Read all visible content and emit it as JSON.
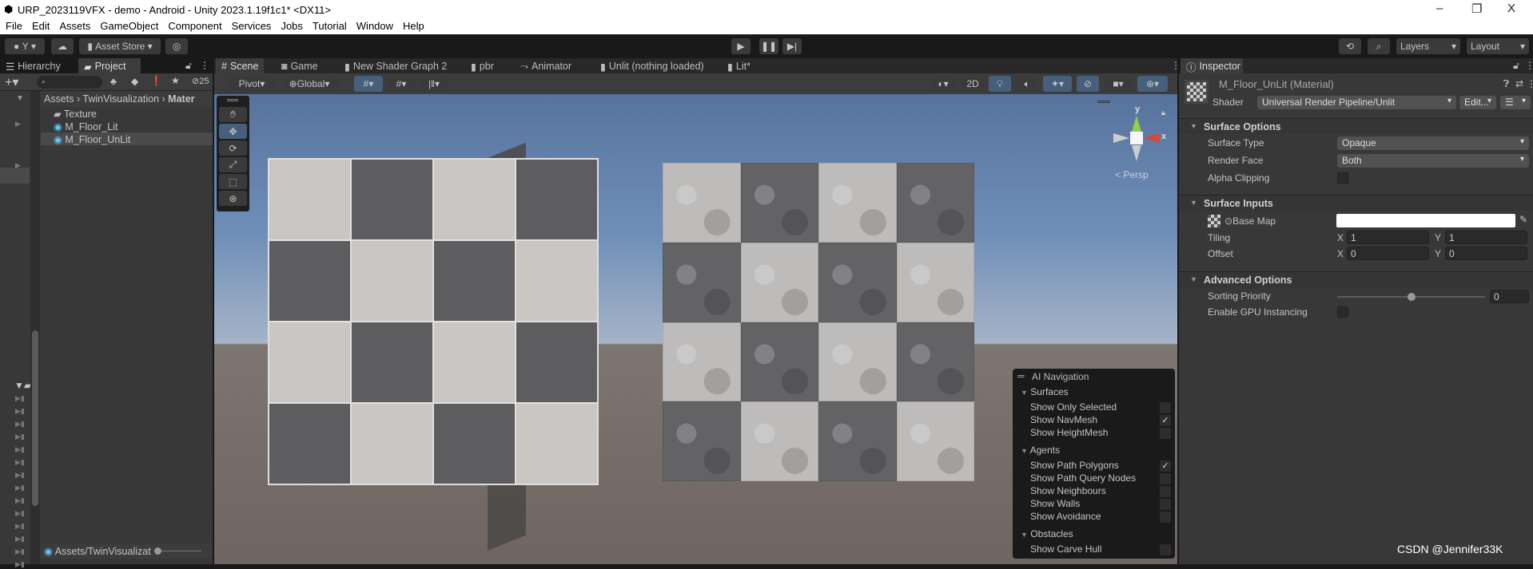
{
  "window": {
    "title": "URP_2023119VFX - demo - Android - Unity 2023.1.19f1c1* <DX11>",
    "minimize": "–",
    "maximize": "❐",
    "close": "X"
  },
  "menu": [
    "File",
    "Edit",
    "Assets",
    "GameObject",
    "Component",
    "Services",
    "Jobs",
    "Tutorial",
    "Window",
    "Help"
  ],
  "toolbar": {
    "account": "Y",
    "asset_store": "Asset Store",
    "layers": "Layers",
    "layout": "Layout"
  },
  "left_tabs": [
    "Hierarchy",
    "Project"
  ],
  "project": {
    "hidden_count": "25",
    "breadcrumb": [
      "Assets",
      "TwinVisualization",
      "Mater"
    ],
    "items": [
      {
        "name": "Texture",
        "type": "folder"
      },
      {
        "name": "M_Floor_Lit",
        "type": "material"
      },
      {
        "name": "M_Floor_UnLit",
        "type": "material",
        "selected": true
      }
    ],
    "footer_path": "Assets/TwinVisualizat"
  },
  "center_tabs": [
    "Scene",
    "Game",
    "New Shader Graph 2",
    "pbr",
    "Animator",
    "Unlit (nothing loaded)",
    "Lit*"
  ],
  "scene_toolbar": {
    "pivot": "Pivot",
    "global": "Global",
    "mode_2d": "2D"
  },
  "gizmo": {
    "y": "y",
    "x": "x",
    "projection": "Persp"
  },
  "ai_navigation": {
    "title": "AI Navigation",
    "sections": [
      {
        "title": "Surfaces",
        "items": [
          {
            "label": "Show Only Selected",
            "checked": false
          },
          {
            "label": "Show NavMesh",
            "checked": true
          },
          {
            "label": "Show HeightMesh",
            "checked": false
          }
        ]
      },
      {
        "title": "Agents",
        "items": [
          {
            "label": "Show Path Polygons",
            "checked": true
          },
          {
            "label": "Show Path Query Nodes",
            "checked": false
          },
          {
            "label": "Show Neighbours",
            "checked": false
          },
          {
            "label": "Show Walls",
            "checked": false
          },
          {
            "label": "Show Avoidance",
            "checked": false
          }
        ]
      },
      {
        "title": "Obstacles",
        "items": [
          {
            "label": "Show Carve Hull",
            "checked": false
          }
        ]
      }
    ]
  },
  "inspector": {
    "tab": "Inspector",
    "title": "M_Floor_UnLit (Material)",
    "shader_label": "Shader",
    "shader": "Universal Render Pipeline/Unlit",
    "edit": "Edit...",
    "surface_options": {
      "header": "Surface Options",
      "surface_type_label": "Surface Type",
      "surface_type": "Opaque",
      "render_face_label": "Render Face",
      "render_face": "Both",
      "alpha_clipping_label": "Alpha Clipping"
    },
    "surface_inputs": {
      "header": "Surface Inputs",
      "base_map_label": "Base Map",
      "tiling_label": "Tiling",
      "offset_label": "Offset",
      "x": "X",
      "y": "Y",
      "tiling_x": "1",
      "tiling_y": "1",
      "offset_x": "0",
      "offset_y": "0",
      "base_color": "#ffffff"
    },
    "advanced": {
      "header": "Advanced Options",
      "sorting_label": "Sorting Priority",
      "sorting_value": "0",
      "sorting_slider_fraction": 0.5,
      "gpu_label": "Enable GPU Instancing"
    }
  },
  "watermark": "CSDN @Jennifer33K"
}
